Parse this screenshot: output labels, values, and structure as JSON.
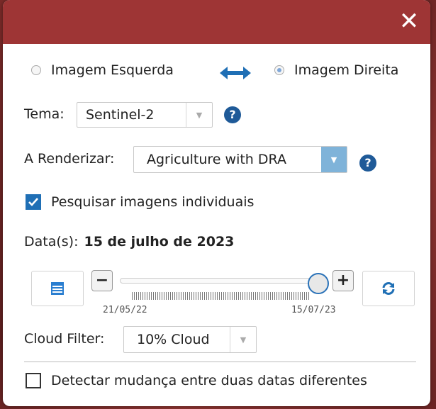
{
  "dialog": {
    "close_icon": "close-icon",
    "titlebar_color": "#9e3535"
  },
  "image_selector": {
    "left_label": "Imagem Esquerda",
    "left_selected": false,
    "swap_icon": "swap-arrows-icon",
    "right_label": "Imagem Direita",
    "right_selected": true
  },
  "theme": {
    "label": "Tema:",
    "value": "Sentinel-2",
    "help_glyph": "?"
  },
  "render": {
    "label": "A Renderizar:",
    "value": "Agriculture with DRA",
    "help_glyph": "?"
  },
  "search_individual": {
    "label": "Pesquisar imagens individuais",
    "checked": true
  },
  "dates": {
    "label": "Data(s):",
    "value": "15 de julho de 2023"
  },
  "slider": {
    "minus": "−",
    "plus": "+",
    "start_label": "21/05/22",
    "end_label": "15/07/23",
    "position_fraction": 1.0,
    "calendar_icon": "calendar-icon",
    "refresh_icon": "refresh-icon",
    "accent": "#2a72b8"
  },
  "cloud_filter": {
    "label": "Cloud Filter:",
    "value": "10% Cloud"
  },
  "change_detection": {
    "label": "Detectar mudança entre duas datas diferentes",
    "checked": false
  }
}
